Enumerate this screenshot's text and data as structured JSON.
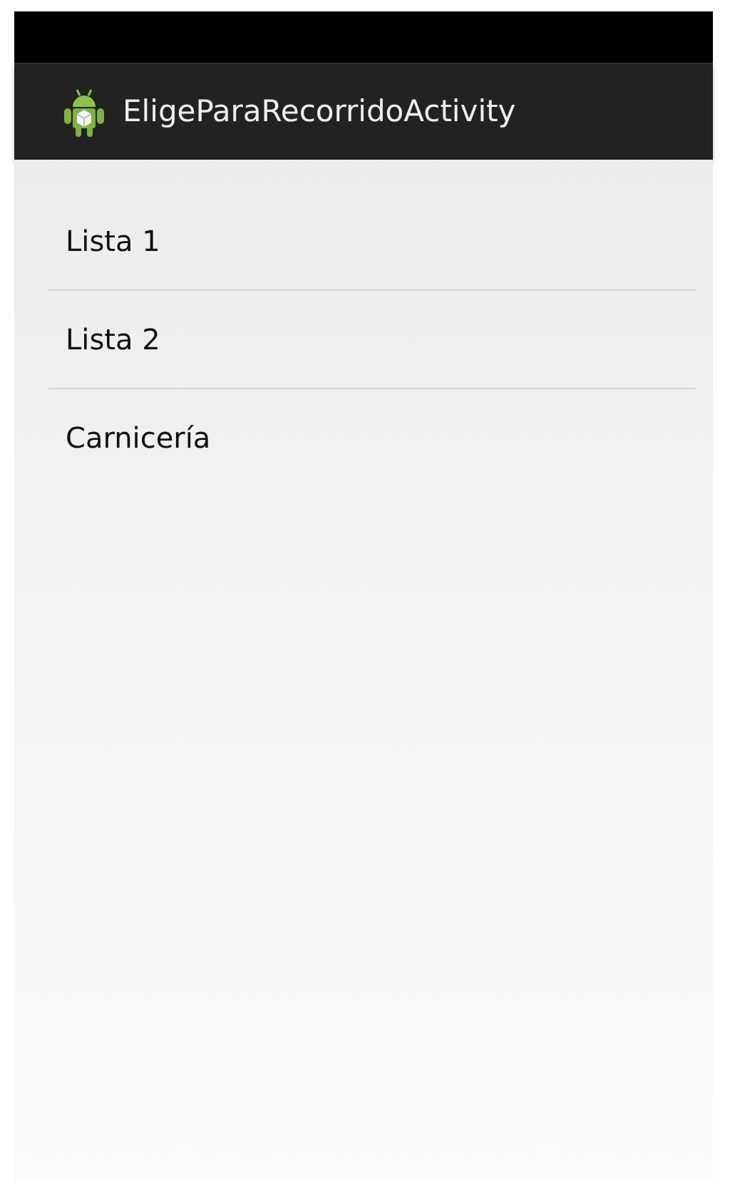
{
  "action_bar": {
    "title": "EligeParaRecorridoActivity"
  },
  "list": {
    "items": [
      {
        "label": "Lista 1"
      },
      {
        "label": "Lista 2"
      },
      {
        "label": "Carnicería"
      }
    ]
  }
}
